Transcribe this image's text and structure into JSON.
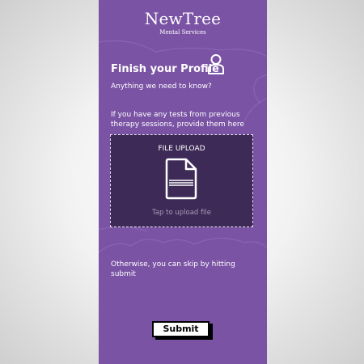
{
  "brand": {
    "name": "NewTree",
    "subtitle": "Mental Services"
  },
  "profile": {
    "title": "Finish your Profile",
    "question": "Anything we need to know?",
    "instructions": "If you have any tests from previous therapy sessions, provide them here",
    "icon": "user-profile-icon"
  },
  "upload": {
    "title": "FILE UPLOAD",
    "hint": "Tap to upload file",
    "icon": "document-icon"
  },
  "skip": {
    "text": "Otherwise, you can skip by hitting submit"
  },
  "actions": {
    "submit_label": "Submit"
  },
  "colors": {
    "background": "#7a53a4",
    "upload_box": "#3d2a57",
    "text": "#ffffff",
    "hint": "#a99bb8"
  }
}
